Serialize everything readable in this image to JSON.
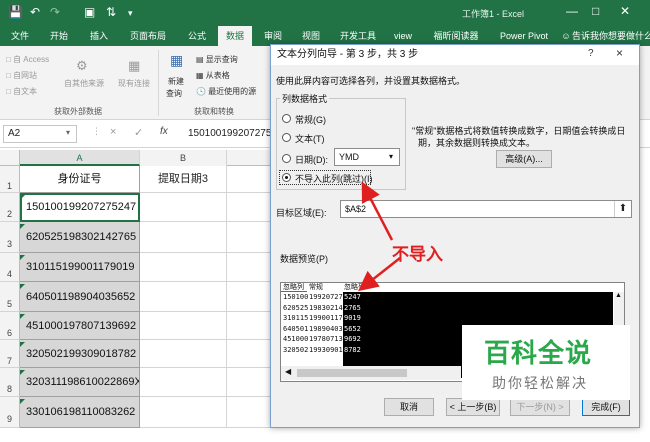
{
  "window": {
    "title": "工作簿1 - Excel",
    "controls": [
      "minimize-icon",
      "maximize-icon",
      "close-icon"
    ]
  },
  "quick_access": [
    "save-icon",
    "undo-icon",
    "redo-icon",
    "print-preview-icon",
    "sort-icon",
    "customize-icon"
  ],
  "ribbon": {
    "tabs": [
      "文件",
      "开始",
      "插入",
      "页面布局",
      "公式",
      "数据",
      "审阅",
      "视图",
      "开发工具",
      "view",
      "福昕阅读器",
      "Power Pivot",
      "告诉我你想要做什么"
    ],
    "active_tab": "数据",
    "get_external": {
      "access": "自 Access",
      "web": "自网站",
      "text": "自文本",
      "other": "自其他来源",
      "existing": "现有连接",
      "group_label": "获取外部数据"
    },
    "get_transform": {
      "new_query_l1": "新建",
      "new_query_l2": "查询",
      "show_queries": "显示查询",
      "from_table": "从表格",
      "recent_sources": "最近使用的源",
      "group_label": "获取和转换"
    }
  },
  "formula_bar": {
    "name_box": "A2",
    "fx": "fx",
    "cancel": "×",
    "enter": "✓",
    "value": "150100199207275247"
  },
  "grid": {
    "columns": [
      "A",
      "B"
    ],
    "rows": [
      {
        "num": "1",
        "a": "身份证号",
        "b": "提取日期3"
      },
      {
        "num": "2",
        "a": "150100199207275247",
        "b": ""
      },
      {
        "num": "3",
        "a": "620525198302142765",
        "b": ""
      },
      {
        "num": "4",
        "a": "310115199001179019",
        "b": ""
      },
      {
        "num": "5",
        "a": "640501198904035652",
        "b": ""
      },
      {
        "num": "6",
        "a": "451000197807139692",
        "b": ""
      },
      {
        "num": "7",
        "a": "320502199309018782",
        "b": ""
      },
      {
        "num": "8",
        "a": "320311198610022869X",
        "b": ""
      },
      {
        "num": "9",
        "a": "330106198110083262",
        "b": ""
      }
    ]
  },
  "dialog": {
    "title": "文本分列向导 - 第 3 步，共 3 步",
    "help": "?",
    "close": "×",
    "instruction": "使用此屏内容可选择各列，并设置其数据格式。",
    "format_group": "列数据格式",
    "options": [
      {
        "label": "常规(G)",
        "selected": false
      },
      {
        "label": "文本(T)",
        "selected": false
      },
      {
        "label": "日期(D):",
        "selected": false
      },
      {
        "label": "不导入此列(跳过)(I)",
        "selected": true
      }
    ],
    "date_format": "YMD",
    "note_line1": "\"常规\"数据格式将数值转换成数字，日期值会转换成日",
    "note_line2": "期，其余数据则转换成文本。",
    "advanced": "高级(A)...",
    "target_label": "目标区域(E):",
    "target_value": "$A$2",
    "preview_label": "数据预览(P)",
    "preview_headers": [
      "忽略列",
      "常规",
      "忽略列"
    ],
    "preview_rows": [
      [
        "150100",
        "19920727",
        "5247"
      ],
      [
        "620525",
        "19830214",
        "2765"
      ],
      [
        "310115",
        "19900117",
        "9019"
      ],
      [
        "640501",
        "19890403",
        "5652"
      ],
      [
        "451000",
        "19780713",
        "9692"
      ],
      [
        "320502",
        "19930901",
        "8782"
      ]
    ],
    "buttons": {
      "cancel": "取消",
      "back": "< 上一步(B)",
      "next": "下一步(N) >",
      "finish": "完成(F)"
    }
  },
  "annotation": "不导入",
  "watermark": {
    "title": "百科全说",
    "subtitle": "助你轻松解决"
  },
  "colors": {
    "excel_green": "#217346",
    "annotation_red": "#e02020",
    "watermark_green": "#2aa84a"
  }
}
